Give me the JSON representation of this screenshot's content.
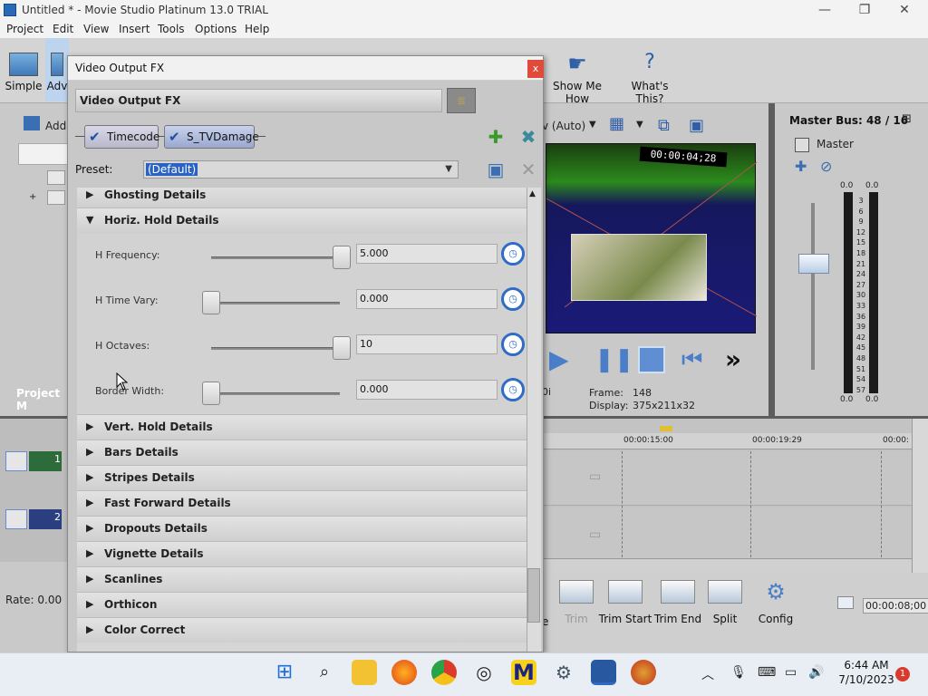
{
  "app": {
    "title": "Untitled * - Movie Studio Platinum 13.0 TRIAL",
    "menus": [
      "Project",
      "Edit",
      "View",
      "Insert",
      "Tools",
      "Options",
      "Help"
    ]
  },
  "toolbar": {
    "simple_label": "Simple",
    "advanced_label": "Adv",
    "show_me_how_label": "Show Me How",
    "whats_this_label": "What's This?"
  },
  "left": {
    "add_label": "Add",
    "project_media_label": "Project M",
    "rate_label": "Rate: 0.00",
    "track1": "1",
    "track2": "2"
  },
  "preview": {
    "mode": "v (Auto)",
    "timecode": "00:00:04;28",
    "frame_label": "Frame:",
    "frame_value": "148",
    "display_label": "Display:",
    "display_value": "375x211x32",
    "left_cut": "0i"
  },
  "master": {
    "bus_label": "Master Bus: 48 / 16",
    "master_label": "Master",
    "peak_left": "0.0",
    "peak_right": "0.0",
    "bottom_left": "0.0",
    "bottom_right": "0.0",
    "scale": [
      "3",
      "6",
      "9",
      "12",
      "15",
      "18",
      "21",
      "24",
      "27",
      "30",
      "33",
      "36",
      "39",
      "42",
      "45",
      "48",
      "51",
      "54",
      "57"
    ]
  },
  "timeline": {
    "ticks": [
      "00:00:15:00",
      "00:00:19:29",
      "00:00:"
    ],
    "duration": "00:00:08;00"
  },
  "bottom": {
    "trim_label": "Trim",
    "trim_start_label": "Trim Start",
    "trim_end_label": "Trim End",
    "split_label": "Split",
    "config_label": "Config",
    "cut_label": "e"
  },
  "dialog": {
    "title": "Video Output FX",
    "close": "x",
    "header": "Video Output FX",
    "chain": [
      "Timecode",
      "S_TVDamage"
    ],
    "preset_label": "Preset:",
    "preset_value": "(Default)",
    "sections_top": [
      "Ghosting Details",
      "Horiz. Hold Details"
    ],
    "rows": [
      {
        "label": "H Frequency:",
        "value": "5.000",
        "level": 1.0
      },
      {
        "label": "H Time Vary:",
        "value": "0.000",
        "level": 0.0
      },
      {
        "label": "H Octaves:",
        "value": "10",
        "level": 1.0
      },
      {
        "label": "Border Width:",
        "value": "0.000",
        "level": 0.0
      }
    ],
    "sections_bottom": [
      "Vert. Hold Details",
      "Bars Details",
      "Stripes Details",
      "Fast Forward Details",
      "Dropouts Details",
      "Vignette Details",
      "Scanlines",
      "Orthicon",
      "Color Correct"
    ]
  },
  "taskbar": {
    "time": "6:44 AM",
    "date": "7/10/2023",
    "notifications": "1"
  }
}
